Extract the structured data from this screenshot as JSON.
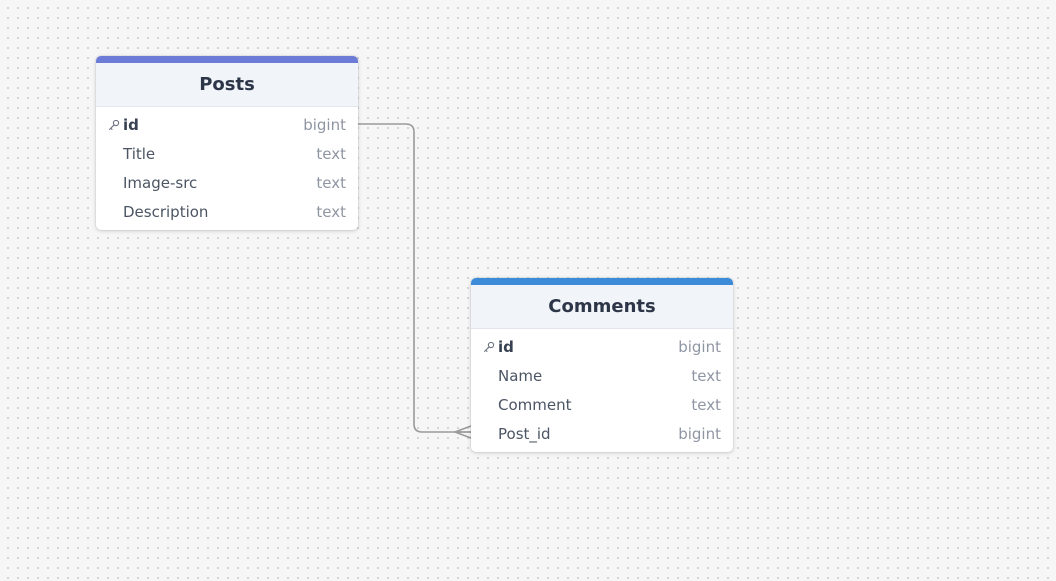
{
  "tables": [
    {
      "name": "Posts",
      "accent_color": "#6b7bd6",
      "fields": [
        {
          "name": "id",
          "type": "bigint",
          "primary_key": true,
          "icon": "key-icon"
        },
        {
          "name": "Title",
          "type": "text",
          "primary_key": false
        },
        {
          "name": "Image-src",
          "type": "text",
          "primary_key": false
        },
        {
          "name": "Description",
          "type": "text",
          "primary_key": false
        }
      ]
    },
    {
      "name": "Comments",
      "accent_color": "#3b8bd9",
      "fields": [
        {
          "name": "id",
          "type": "bigint",
          "primary_key": true,
          "icon": "key-icon"
        },
        {
          "name": "Name",
          "type": "text",
          "primary_key": false
        },
        {
          "name": "Comment",
          "type": "text",
          "primary_key": false
        },
        {
          "name": "Post_id",
          "type": "bigint",
          "primary_key": false
        }
      ]
    }
  ],
  "relationships": [
    {
      "from_table": "Posts",
      "from_field": "id",
      "to_table": "Comments",
      "to_field": "Post_id",
      "cardinality": "one-to-many",
      "line_color": "#9a9a9a"
    }
  ]
}
